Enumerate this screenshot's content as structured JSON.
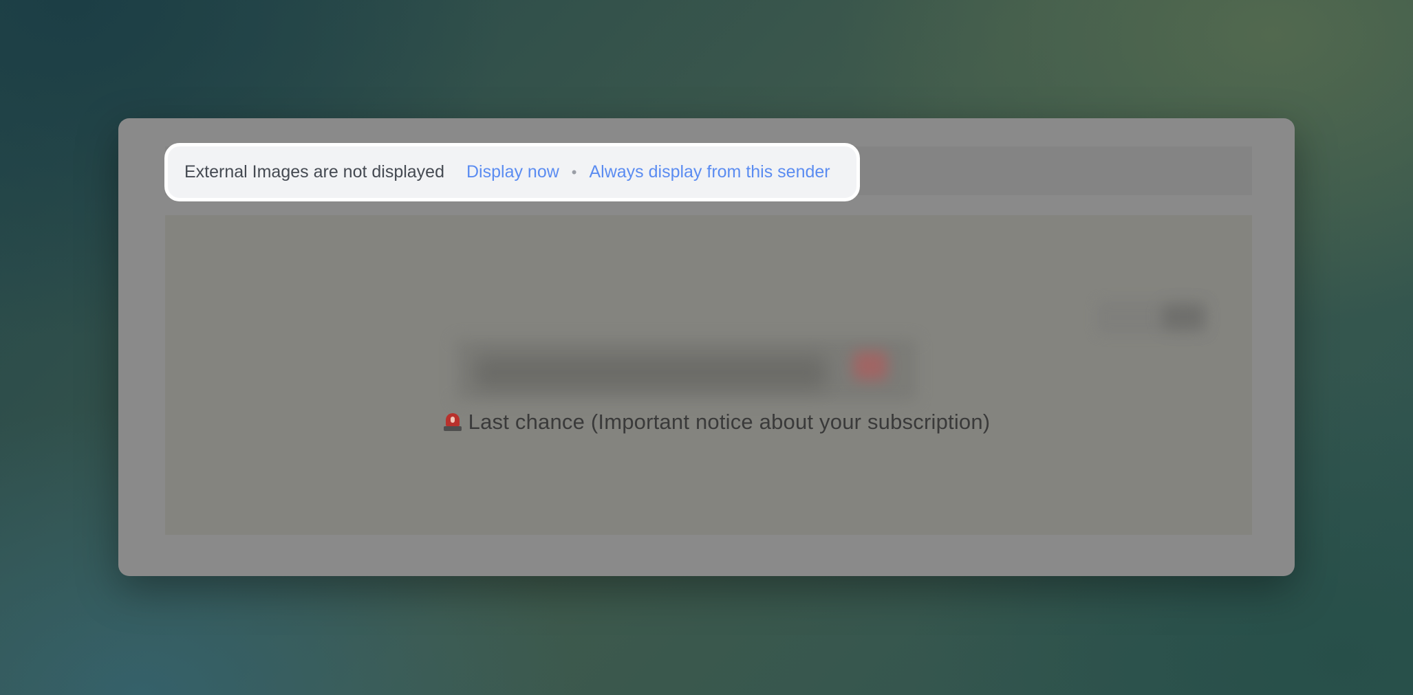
{
  "colors": {
    "accent_link": "#5b8cf1",
    "notice_background": "#f2f3f5",
    "window_overlay": "#8a8a8a"
  },
  "image_notice": {
    "message": "External Images are not displayed",
    "display_now_label": "Display now",
    "separator": "•",
    "always_display_label": "Always display from this sender"
  },
  "email": {
    "subject_icon": "siren-icon",
    "subject_text": "Last chance (Important notice about your subscription)"
  }
}
